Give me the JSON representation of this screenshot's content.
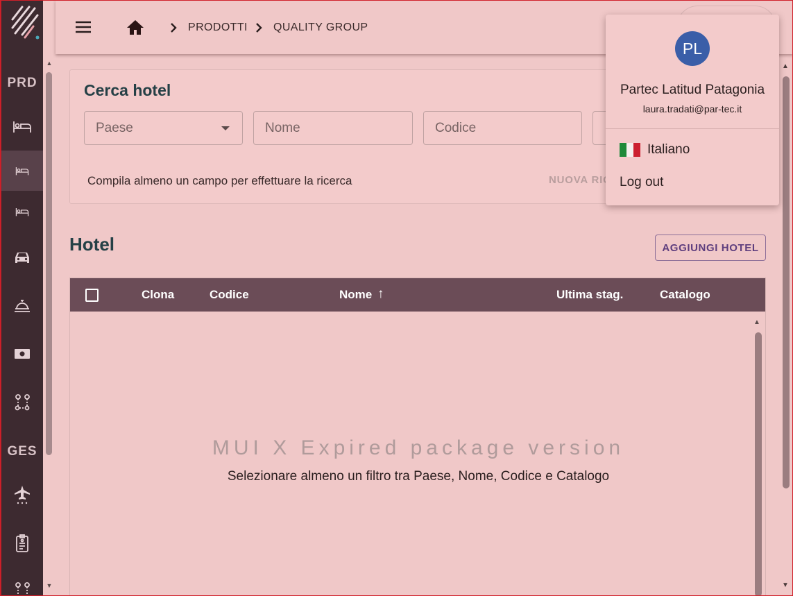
{
  "sidebar": {
    "section_prd": "PRD",
    "section_ges": "GES",
    "items": [
      {
        "icon": "bed-icon"
      },
      {
        "icon": "bed-small-icon",
        "active": true
      },
      {
        "icon": "bed-small-icon"
      },
      {
        "icon": "car-icon"
      },
      {
        "icon": "room-service-icon"
      },
      {
        "icon": "money-icon"
      },
      {
        "icon": "route-icon"
      },
      {
        "icon": "flight-icon"
      },
      {
        "icon": "clipboard-icon"
      },
      {
        "icon": "route-icon"
      }
    ]
  },
  "topbar": {
    "breadcrumb": [
      "PRODOTTI",
      "QUALITY GROUP"
    ]
  },
  "search": {
    "title": "Cerca hotel",
    "fields": {
      "paese": "Paese",
      "nome": "Nome",
      "codice": "Codice"
    },
    "hint": "Compila almeno un campo per effettuare la ricerca",
    "new_search": "NUOVA RICERCA"
  },
  "hotel": {
    "title": "Hotel",
    "add_button": "AGGIUNGI HOTEL",
    "columns": [
      "Clona",
      "Codice",
      "Nome",
      "Ultima stag.",
      "Catalogo"
    ],
    "sort_indicator": "↑",
    "watermark": "MUI X Expired package version",
    "empty_message": "Selezionare almeno un filtro tra Paese, Nome, Codice e Catalogo"
  },
  "user_menu": {
    "initials": "PL",
    "name": "Partec Latitud Patagonia",
    "email": "laura.tradati@par-tec.it",
    "language": "Italiano",
    "logout": "Log out",
    "avatar_color": "#3a5ea8"
  },
  "colors": {
    "sidebar": "#3d2a30",
    "grid_header": "#6b4c57",
    "title": "#254046",
    "accent": "#5e3e7e"
  }
}
